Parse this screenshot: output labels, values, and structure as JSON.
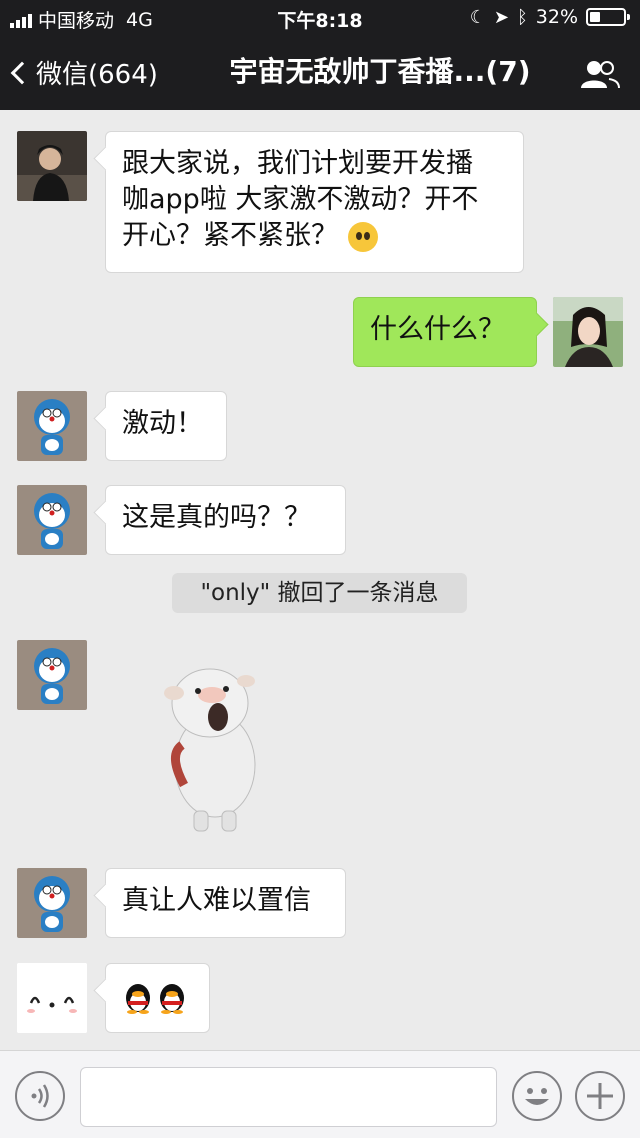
{
  "status_bar": {
    "carrier": "中国移动",
    "network": "4G",
    "time": "下午8:18",
    "battery": "32%",
    "battery_level": 0.32
  },
  "header": {
    "back_label": "微信(664)",
    "title": "宇宙无敌帅丁香播...(7)"
  },
  "messages": [
    {
      "side": "left",
      "text_line1": "跟大家说，我们计划要开发播",
      "text_line2": "咖app啦 大家激不激动？开不",
      "text_line3": "开心？紧不紧张？"
    },
    {
      "side": "right",
      "text": "什么什么？"
    },
    {
      "side": "left",
      "text": "激动！"
    },
    {
      "side": "left",
      "text": "这是真的吗？？"
    },
    {
      "side": "left",
      "type": "sticker"
    },
    {
      "side": "left",
      "text": "真让人难以置信"
    },
    {
      "side": "left",
      "type": "emoji",
      "emoji": "penguin-emoji"
    }
  ],
  "system_tip": "\"only\" 撤回了一条消息",
  "colors": {
    "header_bg": "#1d1d1f",
    "chat_bg": "#ebebeb",
    "sent_bubble": "#a0e75a",
    "received_bubble": "#ffffff"
  },
  "input_bar": {
    "voice_icon": "voice-icon",
    "emoji_icon": "smiley-icon",
    "add_icon": "plus-icon"
  }
}
